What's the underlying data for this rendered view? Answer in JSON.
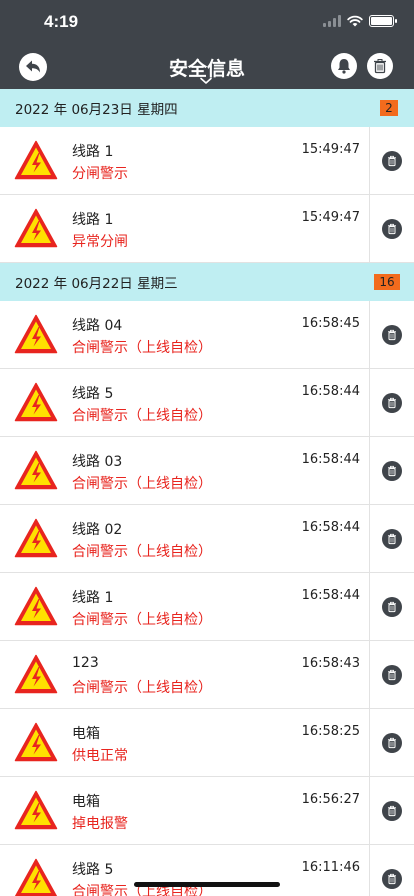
{
  "status_bar": {
    "time": "4:19"
  },
  "nav": {
    "title": "安全信息"
  },
  "groups": [
    {
      "date": "2022 年 06月23日  星期四",
      "count": "2",
      "items": [
        {
          "name": "线路 1",
          "time": "15:49:47",
          "status": "分闸警示"
        },
        {
          "name": "线路 1",
          "time": "15:49:47",
          "status": "异常分闸"
        }
      ]
    },
    {
      "date": "2022 年 06月22日  星期三",
      "count": "16",
      "items": [
        {
          "name": "线路 04",
          "time": "16:58:45",
          "status": "合闸警示（上线自检）"
        },
        {
          "name": "线路 5",
          "time": "16:58:44",
          "status": "合闸警示（上线自检）"
        },
        {
          "name": "线路 03",
          "time": "16:58:44",
          "status": "合闸警示（上线自检）"
        },
        {
          "name": "线路 02",
          "time": "16:58:44",
          "status": "合闸警示（上线自检）"
        },
        {
          "name": "线路 1",
          "time": "16:58:44",
          "status": "合闸警示（上线自检）"
        },
        {
          "name": "123",
          "time": "16:58:43",
          "status": "合闸警示（上线自检）"
        },
        {
          "name": "电箱",
          "time": "16:58:25",
          "status": "供电正常"
        },
        {
          "name": "电箱",
          "time": "16:56:27",
          "status": "掉电报警"
        },
        {
          "name": "线路 5",
          "time": "16:11:46",
          "status": "合闸警示（上线自检）"
        }
      ]
    }
  ],
  "colors": {
    "nav_bg": "#3f444a",
    "date_bg": "#bfeef2",
    "badge": "#f26b1d",
    "status_text": "#e8251f",
    "warning_yellow": "#ffe100",
    "warning_red": "#e8251f"
  },
  "icons": {
    "back": "back-arrow-icon",
    "bell": "bell-icon",
    "trash": "trash-icon",
    "warning": "high-voltage-warning-icon",
    "chevron": "chevron-down-icon"
  }
}
